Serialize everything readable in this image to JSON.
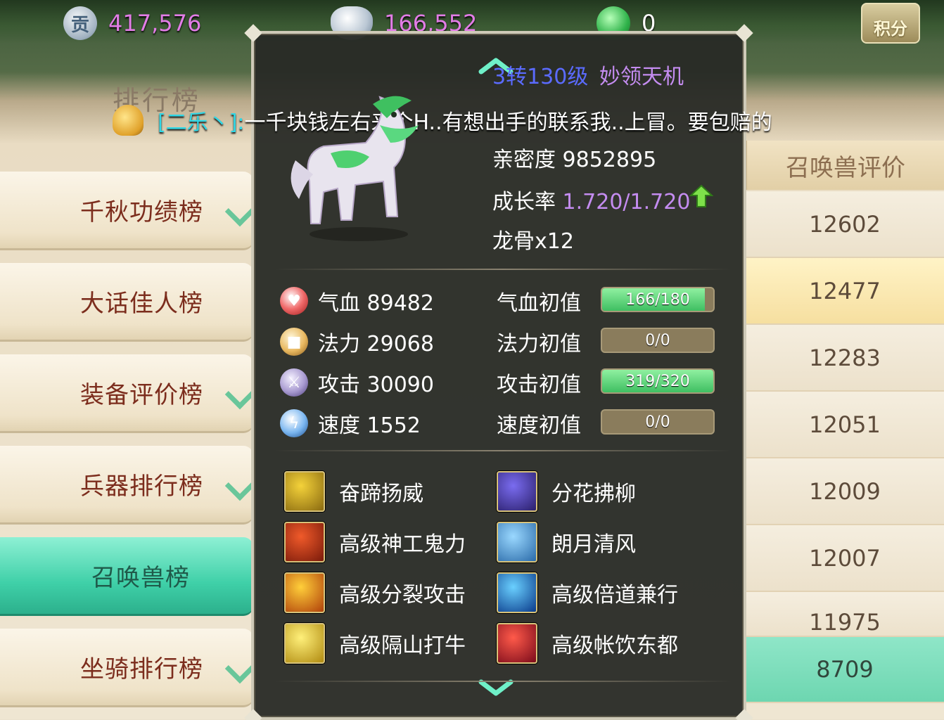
{
  "currencies": [
    {
      "icon": "contribution-coin-icon",
      "glyph": "贡",
      "value": "417,576"
    },
    {
      "icon": "silver-ingot-icon",
      "glyph": "",
      "value": "166,552"
    },
    {
      "icon": "jade-icon",
      "glyph": "",
      "value": "0"
    }
  ],
  "score_button": "积分",
  "panel_title": "排行榜",
  "sidebar": {
    "items": [
      {
        "label": "千秋功绩榜"
      },
      {
        "label": "大话佳人榜"
      },
      {
        "label": "装备评价榜"
      },
      {
        "label": "兵器排行榜"
      },
      {
        "label": "召唤兽榜"
      },
      {
        "label": "坐骑排行榜"
      }
    ]
  },
  "table": {
    "column_header": "召唤兽评价",
    "scores": [
      "12602",
      "12477",
      "12283",
      "12051",
      "12009",
      "12007",
      "11975",
      "8709"
    ]
  },
  "chat": {
    "sender": "[二乐丶]:",
    "message": "一千块钱左右来个H..有想出手的联系我..上冒。要包赔的"
  },
  "pet": {
    "level": "3转130级",
    "name": "妙领天机",
    "intimacy_label": "亲密度",
    "intimacy": "9852895",
    "growth_label": "成长率",
    "growth": "1.720/1.720",
    "item": "龙骨x12",
    "stats": [
      {
        "icon": "heart-icon",
        "label": "气血 89482",
        "init_label": "气血初值",
        "bar": "166/180",
        "fill": 0.922
      },
      {
        "icon": "mana-icon",
        "label": "法力 29068",
        "init_label": "法力初值",
        "bar": "0/0",
        "fill": 0
      },
      {
        "icon": "sword-icon",
        "label": "攻击 30090",
        "init_label": "攻击初值",
        "bar": "319/320",
        "fill": 0.997
      },
      {
        "icon": "lightning-icon",
        "label": "速度 1552",
        "init_label": "速度初值",
        "bar": "0/0",
        "fill": 0
      }
    ],
    "skills": [
      {
        "name": "奋蹄扬威",
        "color1": "#f4d23a",
        "color2": "#8a6a10"
      },
      {
        "name": "分花拂柳",
        "color1": "#7a6cf0",
        "color2": "#2a1f6a"
      },
      {
        "name": "高级神工鬼力",
        "color1": "#f05a2a",
        "color2": "#7a1a0a"
      },
      {
        "name": "朗月清风",
        "color1": "#9ad8ff",
        "color2": "#2a6aa8"
      },
      {
        "name": "高级分裂攻击",
        "color1": "#ffcf3a",
        "color2": "#b0400a"
      },
      {
        "name": "高级倍道兼行",
        "color1": "#6ad0ff",
        "color2": "#0a3a8a"
      },
      {
        "name": "高级隔山打牛",
        "color1": "#fff07a",
        "color2": "#b08a10"
      },
      {
        "name": "高级帐饮东都",
        "color1": "#ff5a4a",
        "color2": "#7a0a1a"
      }
    ]
  }
}
